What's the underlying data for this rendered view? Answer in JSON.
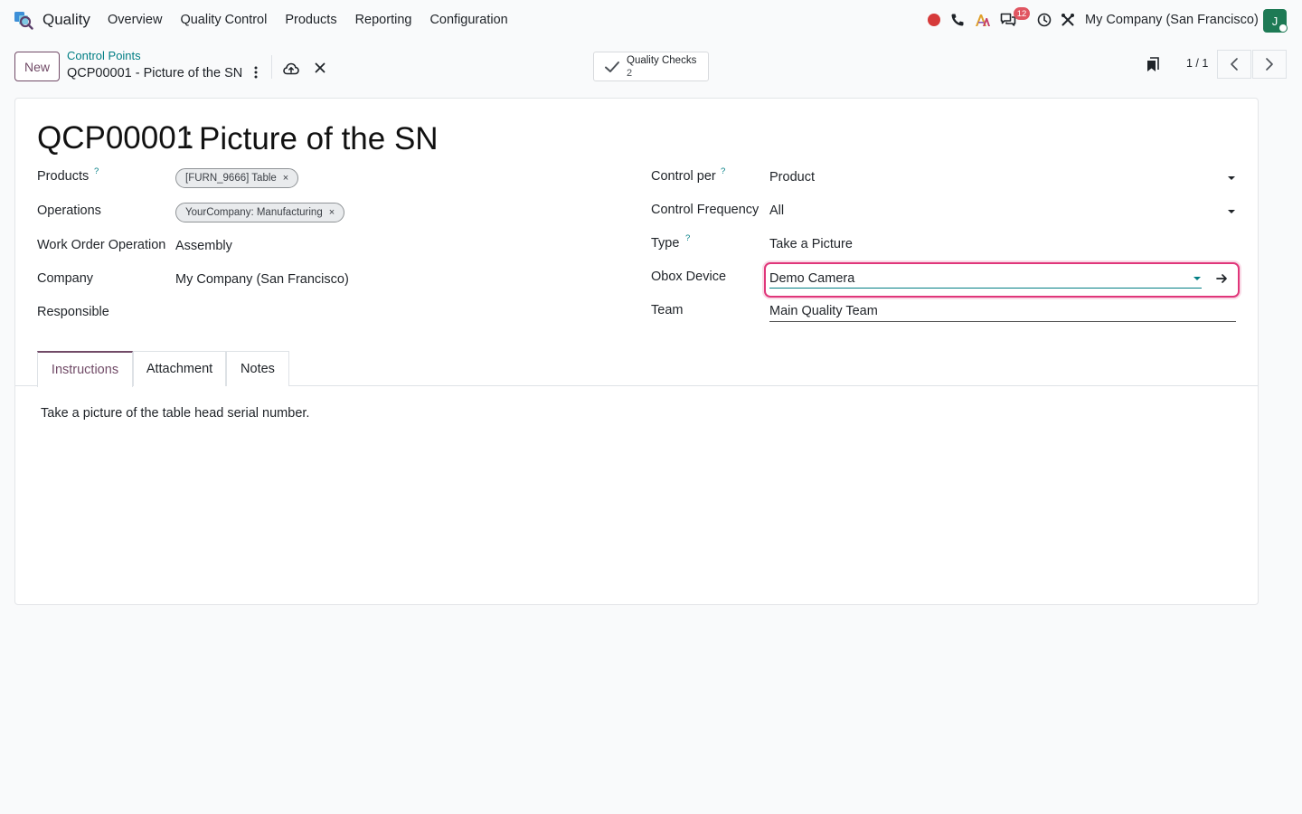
{
  "navbar": {
    "app_name": "Quality",
    "menu": [
      "Overview",
      "Quality Control",
      "Products",
      "Reporting",
      "Configuration"
    ],
    "notification_count": "12",
    "company": "My Company (San Francisco)",
    "avatar_initial": "J",
    "icons": [
      "record-icon",
      "phone-icon",
      "ai-icon",
      "chat-icon",
      "clock-icon",
      "tools-icon"
    ]
  },
  "control_panel": {
    "new_label": "New",
    "breadcrumb_parent": "Control Points",
    "breadcrumb_current": "QCP00001 - Picture of the SN",
    "smart_button": {
      "title": "Quality Checks",
      "value": "2"
    },
    "pager": "1 / 1"
  },
  "form": {
    "reference": "QCP00001",
    "separator": ":",
    "name": "Picture of the SN",
    "left": {
      "products_label": "Products",
      "products_help": "?",
      "products_tags": [
        "[FURN_9666] Table"
      ],
      "operations_label": "Operations",
      "operations_tags": [
        "YourCompany: Manufacturing"
      ],
      "work_order_label": "Work Order Operation",
      "work_order_value": "Assembly",
      "company_label": "Company",
      "company_value": "My Company (San Francisco)",
      "responsible_label": "Responsible"
    },
    "right": {
      "control_per_label": "Control per",
      "control_per_help": "?",
      "control_per_value": "Product",
      "frequency_label": "Control Frequency",
      "frequency_value": "All",
      "type_label": "Type",
      "type_help": "?",
      "type_value": "Take a Picture",
      "obox_label": "Obox Device",
      "obox_value": "Demo Camera",
      "team_label": "Team",
      "team_value": "Main Quality Team"
    },
    "tabs": [
      "Instructions",
      "Attachment",
      "Notes"
    ],
    "active_tab": "Instructions",
    "instructions": "Take a picture of the table head serial number."
  },
  "colors": {
    "brand": "#714b67",
    "link": "#017e84",
    "focus": "#e0367a",
    "badge": "#e05561",
    "avatar": "#1e7a55"
  }
}
